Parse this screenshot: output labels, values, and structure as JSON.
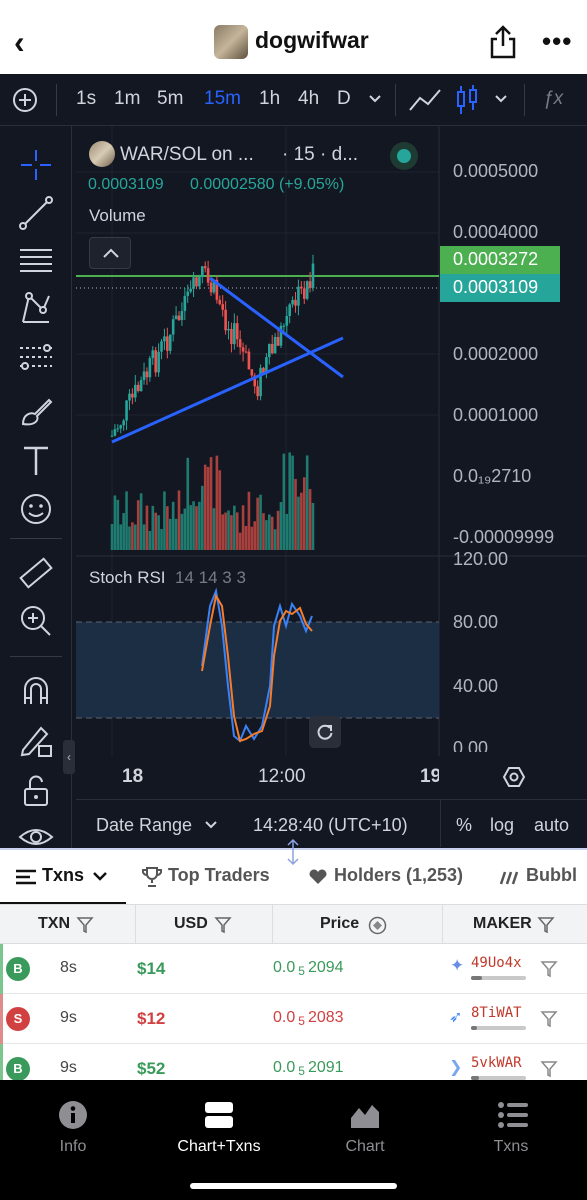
{
  "header": {
    "title": "dogwifwar"
  },
  "toolbar": {
    "intervals": [
      "1s",
      "1m",
      "5m",
      "15m",
      "1h",
      "4h",
      "D"
    ],
    "active_interval": "15m"
  },
  "chart": {
    "symbol": "WAR/SOL on ...",
    "interval_text": "· 15 · d...",
    "last_price": "0.0003109",
    "change": "0.00002580 (+9.05%)",
    "volume_label": "Volume",
    "price_axis": [
      "0.0005000",
      "0.0004000",
      "0.0002000",
      "0.0001000",
      "0.0₁₉2710",
      "-0.00009999"
    ],
    "tag_high": "0.0003272",
    "tag_last": "0.0003109",
    "rsi_label": "Stoch RSI",
    "rsi_params": "14 14 3 3",
    "rsi_axis": [
      "120.00",
      "80.00",
      "40.00",
      "0.00"
    ],
    "time_axis": [
      "18",
      "12:00",
      "19"
    ],
    "date_range": "Date Range",
    "clock": "14:28:40 (UTC+10)",
    "opts": [
      "%",
      "log",
      "auto"
    ]
  },
  "tabs": [
    {
      "label": "Txns"
    },
    {
      "label": "Top Traders"
    },
    {
      "label": "Holders (1,253)"
    },
    {
      "label": "Bubbl"
    }
  ],
  "table": {
    "headers": [
      "TXN",
      "USD",
      "Price",
      "MAKER"
    ],
    "rows": [
      {
        "type": "B",
        "age": "8s",
        "usd": "$14",
        "price_a": "0.0",
        "price_sub": "5",
        "price_b": "2094",
        "maker": "49Uo4x"
      },
      {
        "type": "S",
        "age": "9s",
        "usd": "$12",
        "price_a": "0.0",
        "price_sub": "5",
        "price_b": "2083",
        "maker": "8TiWAT"
      },
      {
        "type": "B",
        "age": "9s",
        "usd": "$52",
        "price_a": "0.0",
        "price_sub": "5",
        "price_b": "2091",
        "maker": "5vkWAR"
      }
    ]
  },
  "bottom_nav": [
    {
      "label": "Info"
    },
    {
      "label": "Chart+Txns"
    },
    {
      "label": "Chart"
    },
    {
      "label": "Txns"
    }
  ],
  "colors": {
    "buy": "#3a9a5b",
    "sell": "#d14141",
    "accent": "#2962ff",
    "chart_bg": "#131722"
  }
}
